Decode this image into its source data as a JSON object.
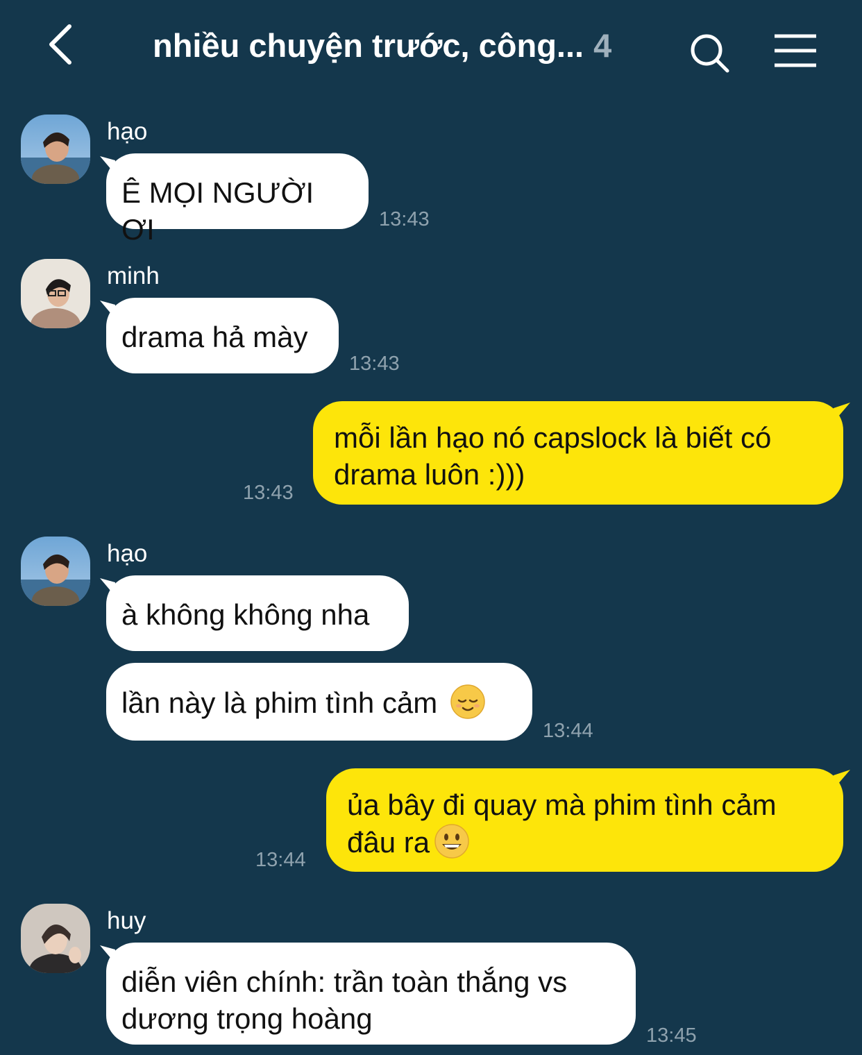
{
  "header": {
    "title": "nhiều chuyện trước, công...",
    "member_count": "4",
    "back_icon": "chevron-left-icon",
    "search_icon": "search-icon",
    "menu_icon": "hamburger-menu-icon"
  },
  "colors": {
    "background": "#14374c",
    "incoming_bubble": "#ffffff",
    "outgoing_bubble": "#fde50a",
    "timestamp": "#8fa2ae"
  },
  "messages": [
    {
      "sender": "hạo",
      "direction": "in",
      "text": "Ê MỌI NGƯỜI ƠI",
      "time": "13:43"
    },
    {
      "sender": "minh",
      "direction": "in",
      "text": "drama hả mày",
      "time": "13:43"
    },
    {
      "direction": "out",
      "line1": "mỗi lần hạo nó capslock là biết có",
      "line2": "drama luôn :)))",
      "time": "13:43"
    },
    {
      "sender": "hạo",
      "direction": "in",
      "text": "à không không nha"
    },
    {
      "direction": "in",
      "text": "lần này là phim tình cảm",
      "emoji": "relieved-face-emoji",
      "time": "13:44"
    },
    {
      "direction": "out",
      "line1": "ủa bây đi quay mà phim tình cảm",
      "line2": "đâu ra",
      "emoji": "grinning-face-emoji",
      "time": "13:44"
    },
    {
      "sender": "huy",
      "direction": "in",
      "line1": "diễn viên chính: trần toàn thắng vs",
      "line2": "dương trọng hoàng",
      "time": "13:45"
    }
  ]
}
